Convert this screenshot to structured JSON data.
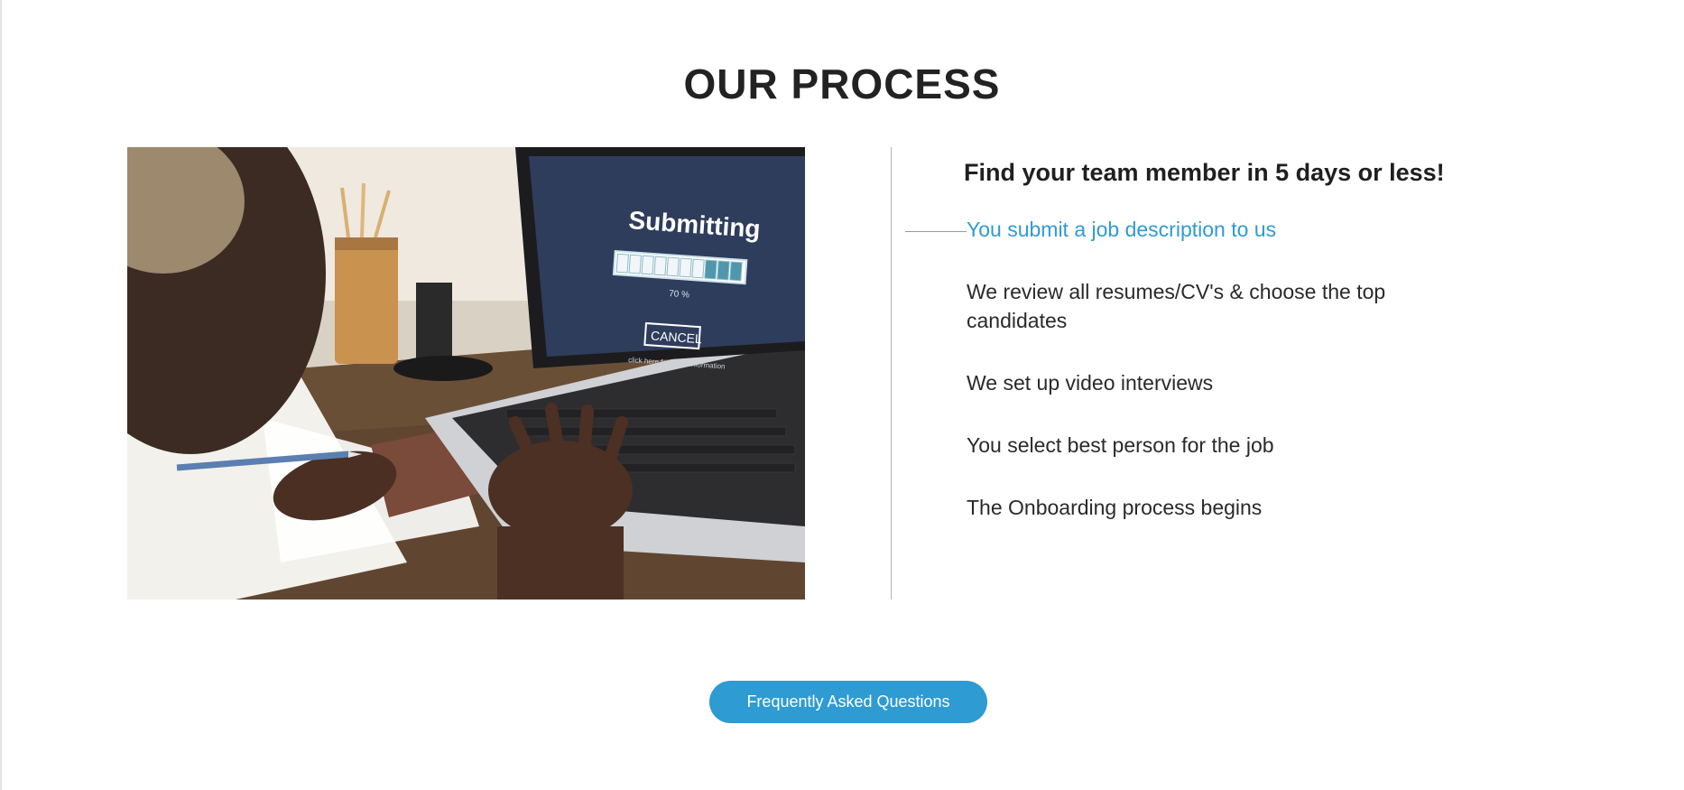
{
  "section": {
    "title": "OUR PROCESS"
  },
  "image": {
    "screen_title": "Submitting",
    "progress_percent": 70,
    "progress_label": "70 %",
    "cancel_label": "CANCEL",
    "hint_text": "click here for more information"
  },
  "process": {
    "heading": "Find your team member in 5 days or less!",
    "active_step": 0,
    "steps": [
      "You submit a job description to us",
      "We review all resumes/CV's & choose the top candidates",
      "We set up video interviews",
      "You select best person for the job",
      "The Onboarding process begins"
    ]
  },
  "faq_button": {
    "label": "Frequently Asked Questions"
  },
  "colors": {
    "accent": "#2e9bd3",
    "heading": "#222222",
    "text": "#2a2a2a",
    "divider": "#b5b5b5"
  }
}
